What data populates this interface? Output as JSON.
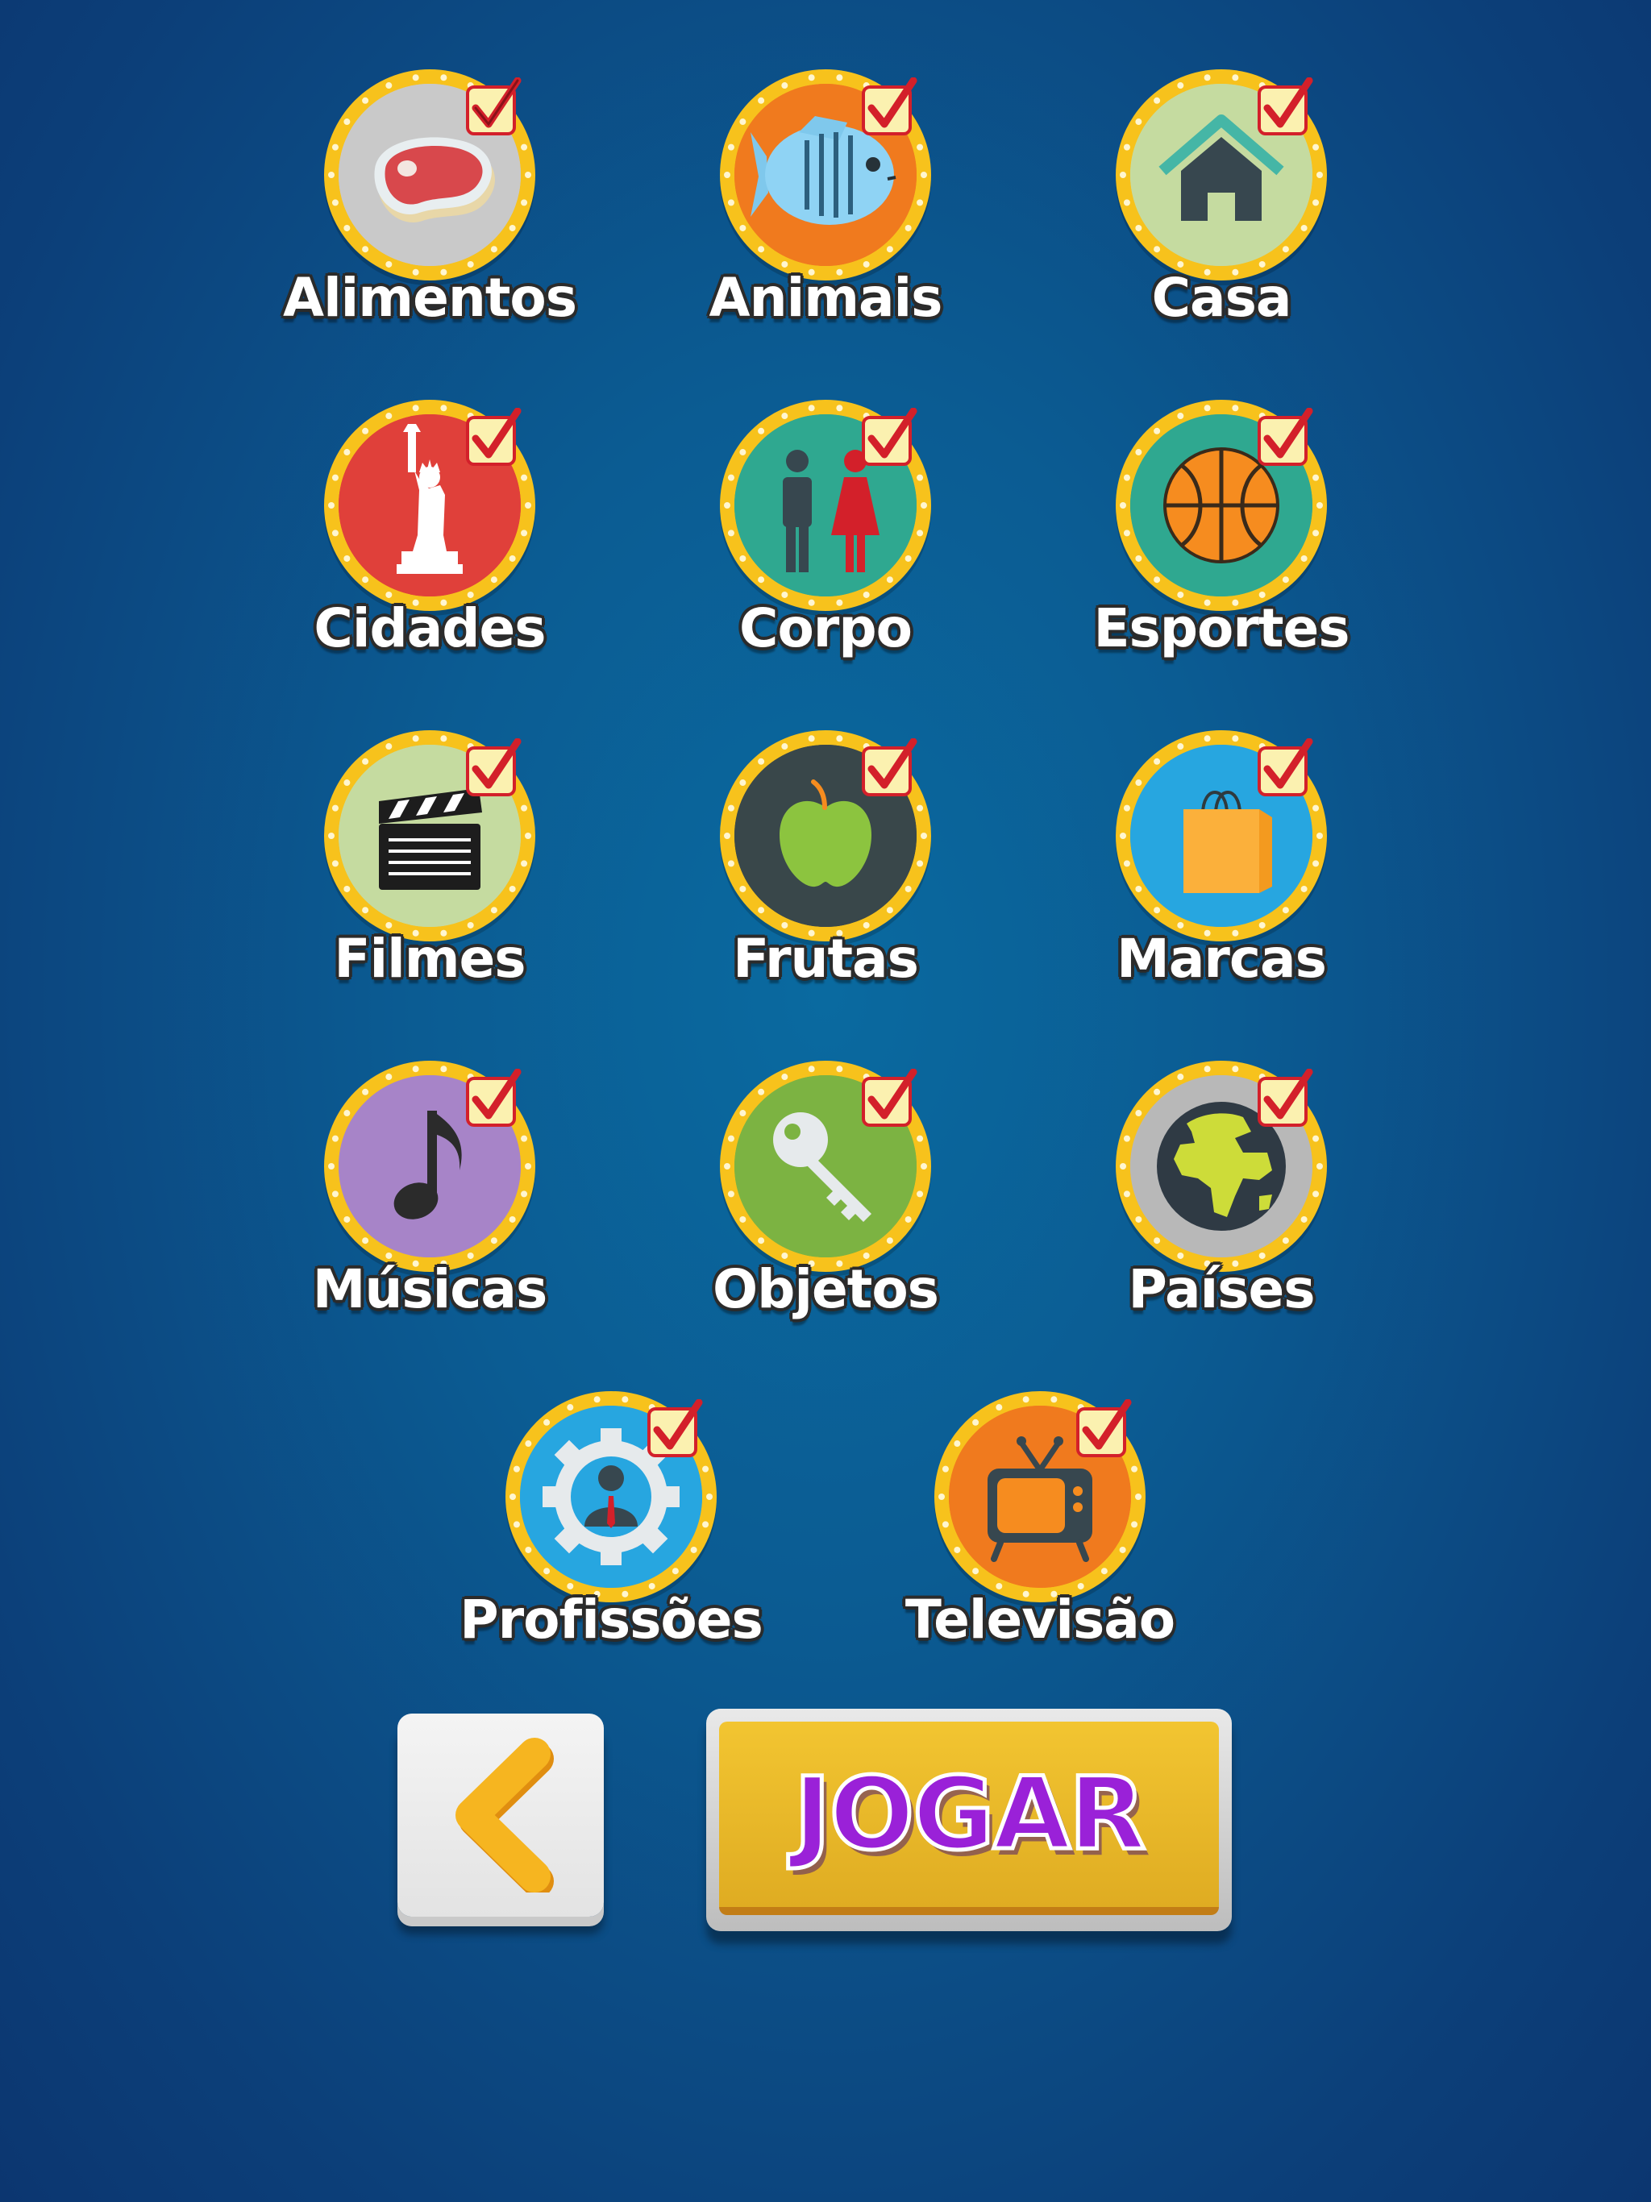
{
  "categories": [
    {
      "id": "alimentos",
      "label": "Alimentos",
      "icon": "steak-icon",
      "bg": "#c9c9c9",
      "selected": true
    },
    {
      "id": "animais",
      "label": "Animais",
      "icon": "fish-icon",
      "bg": "#f07a1e",
      "selected": true
    },
    {
      "id": "casa",
      "label": "Casa",
      "icon": "house-icon",
      "bg": "#c5dba0",
      "selected": true
    },
    {
      "id": "cidades",
      "label": "Cidades",
      "icon": "statue-of-liberty-icon",
      "bg": "#e0403a",
      "selected": true
    },
    {
      "id": "corpo",
      "label": "Corpo",
      "icon": "man-woman-icon",
      "bg": "#2fa890",
      "selected": true
    },
    {
      "id": "esportes",
      "label": "Esportes",
      "icon": "basketball-icon",
      "bg": "#2fa890",
      "selected": true
    },
    {
      "id": "filmes",
      "label": "Filmes",
      "icon": "clapperboard-icon",
      "bg": "#c5dba0",
      "selected": true
    },
    {
      "id": "frutas",
      "label": "Frutas",
      "icon": "apple-icon",
      "bg": "#39474a",
      "selected": true
    },
    {
      "id": "marcas",
      "label": "Marcas",
      "icon": "shopping-bag-icon",
      "bg": "#27a6e0",
      "selected": true
    },
    {
      "id": "musicas",
      "label": "Músicas",
      "icon": "music-note-icon",
      "bg": "#a784c8",
      "selected": true
    },
    {
      "id": "objetos",
      "label": "Objetos",
      "icon": "key-icon",
      "bg": "#7cb342",
      "selected": true
    },
    {
      "id": "paises",
      "label": "Países",
      "icon": "globe-icon",
      "bg": "#b8b8b8",
      "selected": true
    },
    {
      "id": "profissoes",
      "label": "Profissões",
      "icon": "worker-gear-icon",
      "bg": "#27a6e0",
      "selected": true
    },
    {
      "id": "televisao",
      "label": "Televisão",
      "icon": "tv-icon",
      "bg": "#f07a1e",
      "selected": true
    }
  ],
  "buttons": {
    "back_icon": "chevron-left-icon",
    "play_label": "JOGAR"
  },
  "colors": {
    "badge_ring": "#f7c21c",
    "check_red": "#d3202a",
    "play_text": "#9a21d8",
    "back_chevron": "#f6b520"
  }
}
